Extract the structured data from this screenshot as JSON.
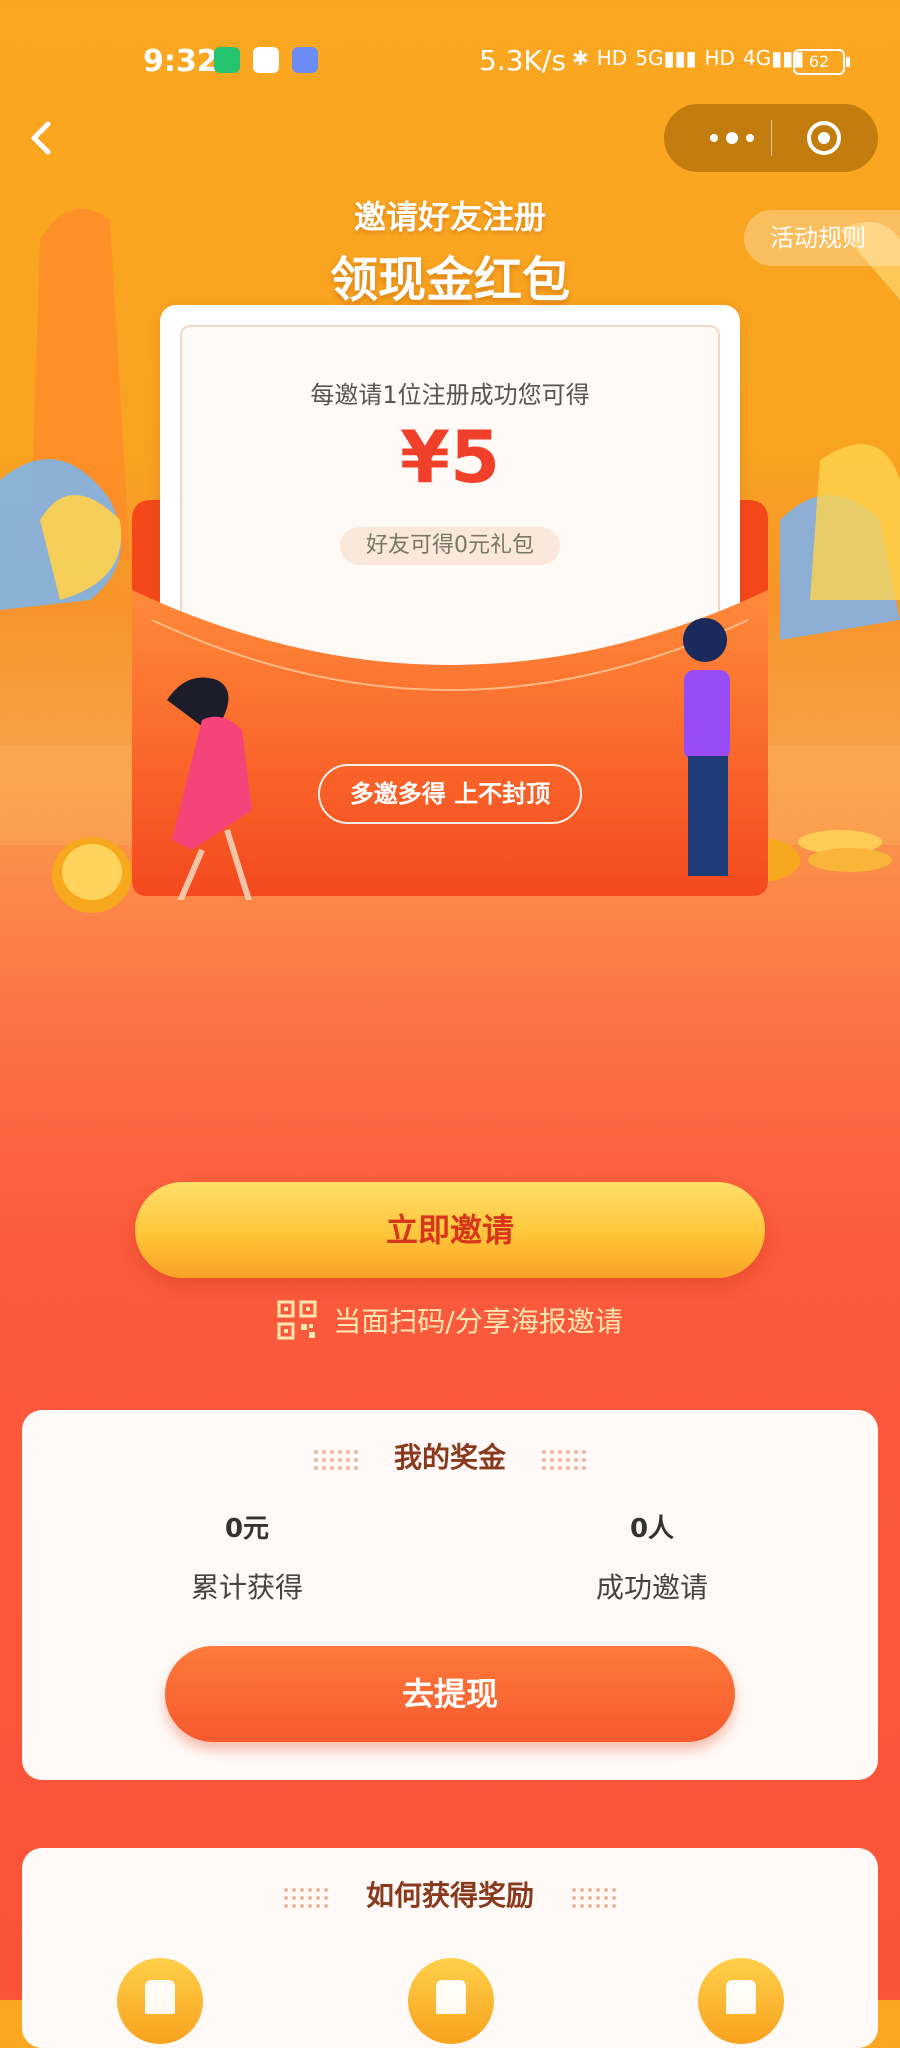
{
  "status_bar": {
    "time": "9:32",
    "network_speed": "5.3K/s",
    "icons": [
      "bluetooth-icon",
      "hd-icon",
      "5g-signal-icon",
      "hd-icon",
      "4g-signal-icon"
    ],
    "signal_labels": [
      "HD",
      "5G",
      "HD",
      "4G"
    ],
    "battery": "62"
  },
  "nav": {
    "back_icon": "chevron-left-icon",
    "more_icon": "more-dots-icon",
    "close_icon": "target-circle-icon"
  },
  "header": {
    "title_line1": "邀请好友注册",
    "title_line2": "领现金红包",
    "rules_button": "活动规则"
  },
  "envelope": {
    "subtitle": "每邀请1位注册成功您可得",
    "amount": "¥5",
    "friend_gift": "好友可得0元礼包",
    "slogan": "多邀多得 上不封顶"
  },
  "actions": {
    "invite_button": "立即邀请",
    "qr_text": "当面扫码/分享海报邀请"
  },
  "my_bonus": {
    "title": "我的奖金",
    "stats": [
      {
        "value": "0元",
        "label": "累计获得"
      },
      {
        "value": "0人",
        "label": "成功邀请"
      }
    ],
    "withdraw_button": "去提现"
  },
  "how_to": {
    "title": "如何获得奖励"
  },
  "colors": {
    "brand_orange": "#fa5338",
    "gold": "#ffc53a",
    "amount_red": "#f0402a"
  }
}
